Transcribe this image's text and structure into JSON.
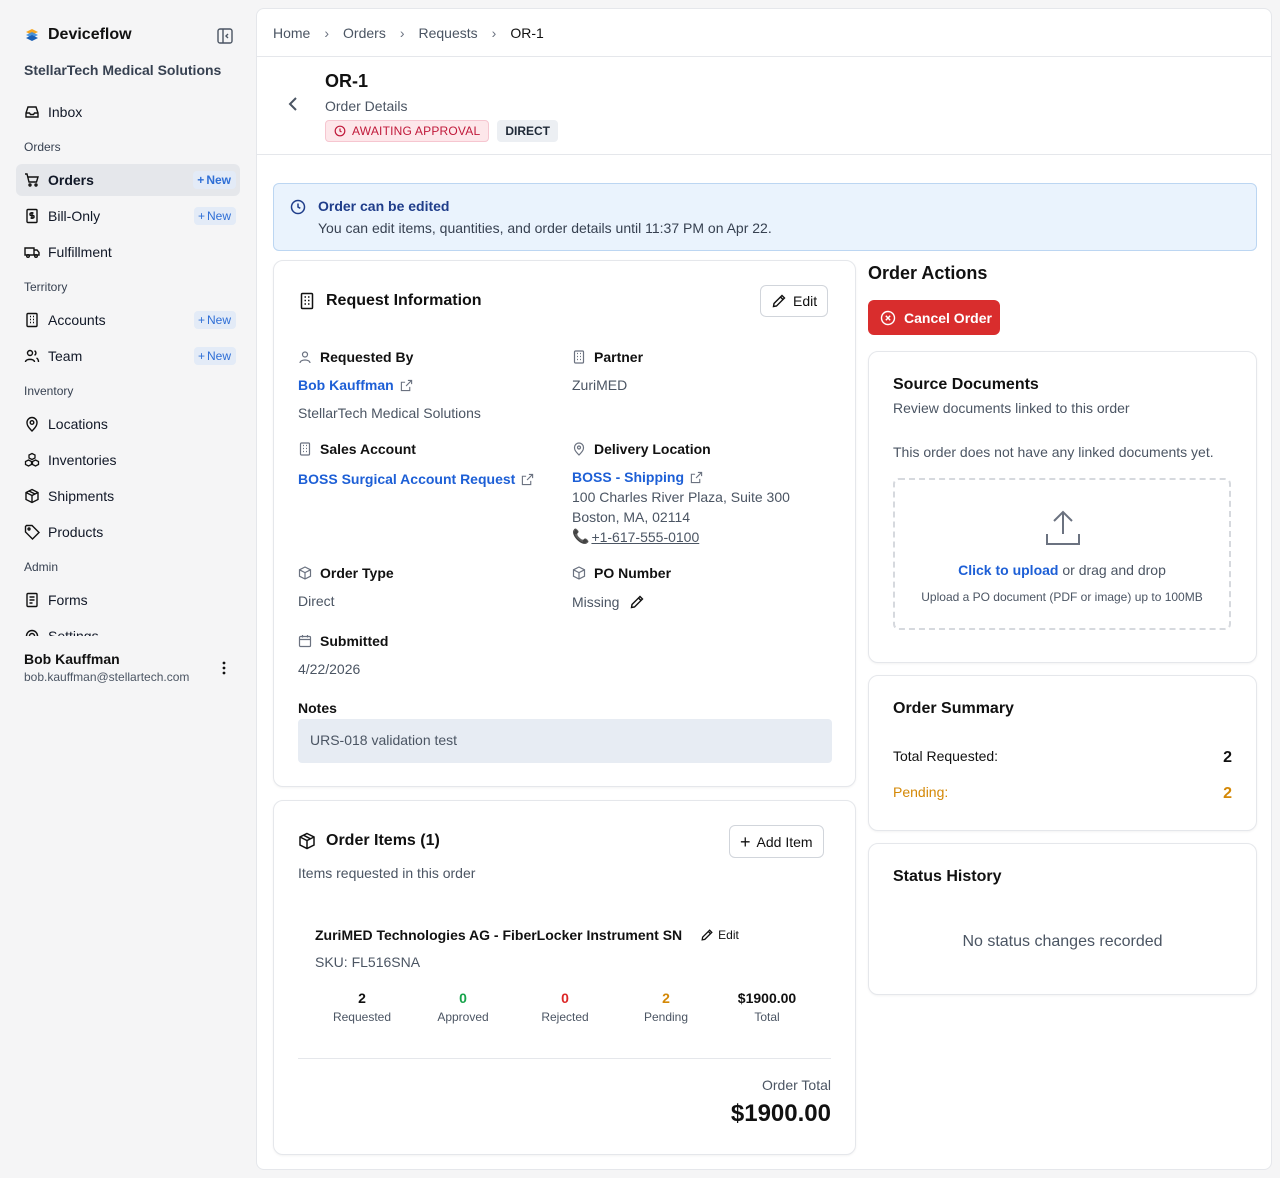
{
  "sidebar": {
    "brand": "Deviceflow",
    "org": "StellarTech Medical Solutions",
    "new_label": "New",
    "items": [
      {
        "label": "Inbox"
      },
      {
        "label": "Orders"
      },
      {
        "label": "Bill-Only"
      },
      {
        "label": "Fulfillment"
      },
      {
        "label": "Accounts"
      },
      {
        "label": "Team"
      },
      {
        "label": "Locations"
      },
      {
        "label": "Inventories"
      },
      {
        "label": "Shipments"
      },
      {
        "label": "Products"
      },
      {
        "label": "Forms"
      },
      {
        "label": "Settings"
      }
    ],
    "sections": {
      "orders": "Orders",
      "territory": "Territory",
      "inventory": "Inventory",
      "admin": "Admin"
    },
    "active": "Orders",
    "user": {
      "name": "Bob Kauffman",
      "email": "bob.kauffman@stellartech.com"
    }
  },
  "breadcrumb": [
    "Home",
    "Orders",
    "Requests",
    "OR-1"
  ],
  "header": {
    "title": "OR-1",
    "subtitle": "Order Details",
    "status_badge": "AWAITING APPROVAL",
    "type_badge": "DIRECT"
  },
  "alert": {
    "title": "Order can be edited",
    "text": "You can edit items, quantities, and order details until 11:37 PM on Apr 22."
  },
  "request_info": {
    "title": "Request Information",
    "edit_label": "Edit",
    "requested_by_label": "Requested By",
    "requested_by": "Bob Kauffman",
    "requested_by_org": "StellarTech Medical Solutions",
    "partner_label": "Partner",
    "partner": "ZuriMED",
    "sales_account_label": "Sales Account",
    "sales_account": "BOSS Surgical Account Request",
    "delivery_label": "Delivery Location",
    "delivery_name": "BOSS - Shipping",
    "delivery_line1": "100 Charles River Plaza, Suite 300",
    "delivery_line2": "Boston, MA, 02114",
    "delivery_phone": "+1-617-555-0100",
    "order_type_label": "Order Type",
    "order_type": "Direct",
    "po_label": "PO Number",
    "po_value": "Missing",
    "submitted_label": "Submitted",
    "submitted": "4/22/2026",
    "notes_label": "Notes",
    "notes": "URS-018 validation test"
  },
  "order_items": {
    "title": "Order Items (1)",
    "subtitle": "Items requested in this order",
    "add_label": "Add Item",
    "items": [
      {
        "name": "ZuriMED Technologies AG - FiberLocker Instrument SN",
        "edit_label": "Edit",
        "sku": "SKU: FL516SNA",
        "requested": "2",
        "requested_label": "Requested",
        "approved": "0",
        "approved_label": "Approved",
        "rejected": "0",
        "rejected_label": "Rejected",
        "pending": "2",
        "pending_label": "Pending",
        "total": "$1900.00",
        "total_label": "Total"
      }
    ],
    "order_total_label": "Order Total",
    "order_total": "$1900.00"
  },
  "actions": {
    "title": "Order Actions",
    "cancel_label": "Cancel Order"
  },
  "source_docs": {
    "title": "Source Documents",
    "subtitle": "Review documents linked to this order",
    "empty": "This order does not have any linked documents yet.",
    "upload_link": "Click to upload",
    "upload_rest": " or drag and drop",
    "upload_hint": "Upload a PO document (PDF or image) up to 100MB"
  },
  "summary": {
    "title": "Order Summary",
    "total_requested_label": "Total Requested:",
    "total_requested": "2",
    "pending_label": "Pending:",
    "pending": "2"
  },
  "status_history": {
    "title": "Status History",
    "empty": "No status changes recorded"
  },
  "colors": {
    "accent": "#1d5fd6",
    "danger": "#d92d2d",
    "approved": "#16a34a",
    "rejected": "#dc2626",
    "pending": "#d48806"
  }
}
